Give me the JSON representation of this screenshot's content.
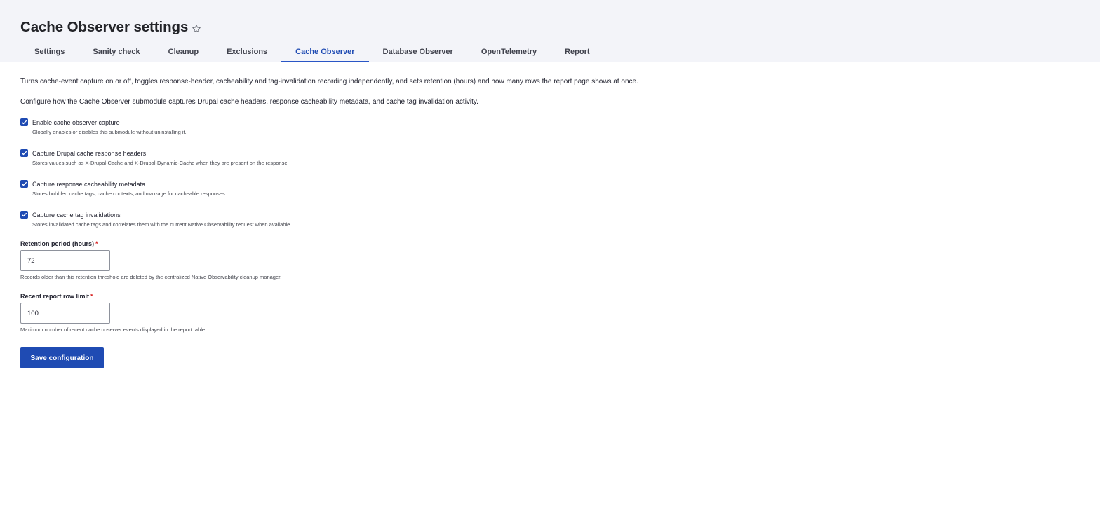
{
  "page": {
    "title": "Cache Observer settings",
    "favorite_icon": "star-outline-icon"
  },
  "tabs": [
    {
      "label": "Settings",
      "active": false
    },
    {
      "label": "Sanity check",
      "active": false
    },
    {
      "label": "Cleanup",
      "active": false
    },
    {
      "label": "Exclusions",
      "active": false
    },
    {
      "label": "Cache Observer",
      "active": true
    },
    {
      "label": "Database Observer",
      "active": false
    },
    {
      "label": "OpenTelemetry",
      "active": false
    },
    {
      "label": "Report",
      "active": false
    }
  ],
  "intro": {
    "summary": "Turns cache-event capture on or off, toggles response-header, cacheability and tag-invalidation recording independently, and sets retention (hours) and how many rows the report page shows at once.",
    "description": "Configure how the Cache Observer submodule captures Drupal cache headers, response cacheability metadata, and cache tag invalidation activity."
  },
  "checkboxes": [
    {
      "label": "Enable cache observer capture",
      "description": "Globally enables or disables this submodule without uninstalling it.",
      "checked": true
    },
    {
      "label": "Capture Drupal cache response headers",
      "description": "Stores values such as X-Drupal-Cache and X-Drupal-Dynamic-Cache when they are present on the response.",
      "checked": true
    },
    {
      "label": "Capture response cacheability metadata",
      "description": "Stores bubbled cache tags, cache contexts, and max-age for cacheable responses.",
      "checked": true
    },
    {
      "label": "Capture cache tag invalidations",
      "description": "Stores invalidated cache tags and correlates them with the current Native Observability request when available.",
      "checked": true
    }
  ],
  "retention": {
    "label": "Retention period (hours)",
    "required_marker": "*",
    "value": "72",
    "description": "Records older than this retention threshold are deleted by the centralized Native Observability cleanup manager."
  },
  "row_limit": {
    "label": "Recent report row limit",
    "required_marker": "*",
    "value": "100",
    "description": "Maximum number of recent cache observer events displayed in the report table."
  },
  "actions": {
    "save_label": "Save configuration"
  },
  "colors": {
    "accent": "#1f4bb3",
    "header_bg": "#f3f4f9",
    "required": "#d72222"
  }
}
